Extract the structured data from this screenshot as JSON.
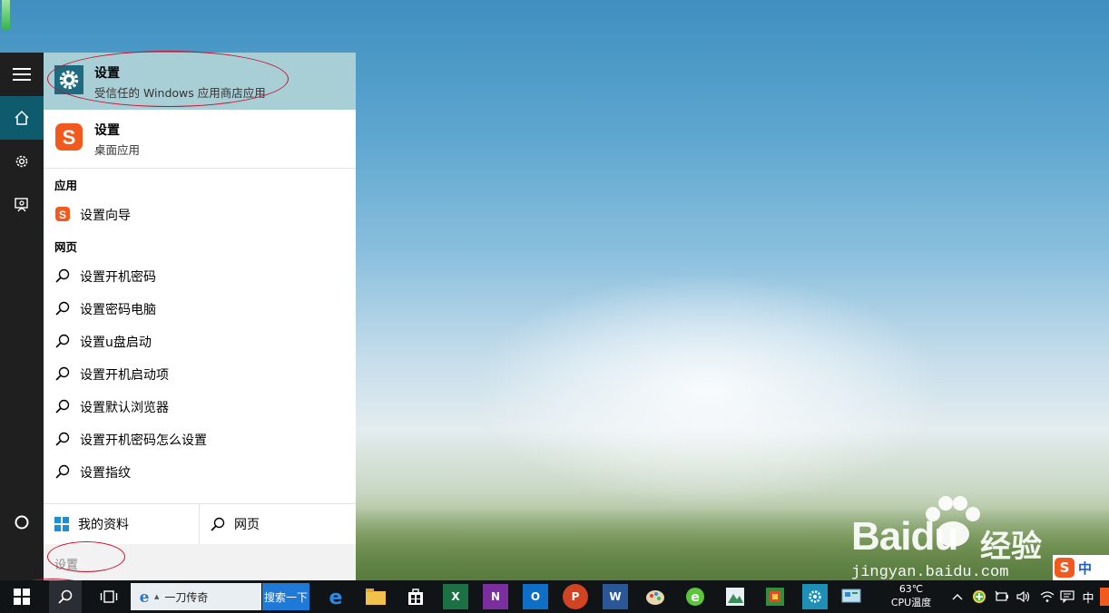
{
  "top_result": {
    "title": "设置",
    "subtitle": "受信任的 Windows 应用商店应用"
  },
  "second_result": {
    "title": "设置",
    "subtitle": "桌面应用"
  },
  "sections": {
    "apps": "应用",
    "web": "网页"
  },
  "apps": [
    {
      "label": "设置向导",
      "icon": "sogou-icon"
    }
  ],
  "web_results": [
    "设置开机密码",
    "设置密码电脑",
    "设置u盘启动",
    "设置开机启动项",
    "设置默认浏览器",
    "设置开机密码怎么设置",
    "设置指纹"
  ],
  "bottom_bar": {
    "my_stuff": "我的资料",
    "web": "网页"
  },
  "search_box": {
    "value": "设置"
  },
  "taskbar": {
    "browser_tab_label": "一刀传奇",
    "search_button": "搜索一下",
    "apps": [
      "edge-icon",
      "file-explorer-icon",
      "store-icon",
      "excel-icon",
      "onenote-icon",
      "outlook-icon",
      "powerpoint-icon",
      "word-icon",
      "paint-icon",
      "green-app-icon",
      "photos-icon",
      "chart-app-icon",
      "settings-icon",
      "control-panel-icon"
    ],
    "temperature": "63℃",
    "temperature_label": "CPU温度",
    "ime_language": "中"
  },
  "watermark": {
    "brand": "Bai",
    "brand_suffix": "du",
    "brand_chinese": "经验",
    "url": "jingyan.baidu.com"
  },
  "ime_bar": {
    "logo": "S",
    "lang": "中"
  },
  "colors": {
    "accent": "#0e5b6e",
    "top_result_bg": "#a9cfd6",
    "annotation": "#c8102e",
    "taskbar": "#101417"
  }
}
